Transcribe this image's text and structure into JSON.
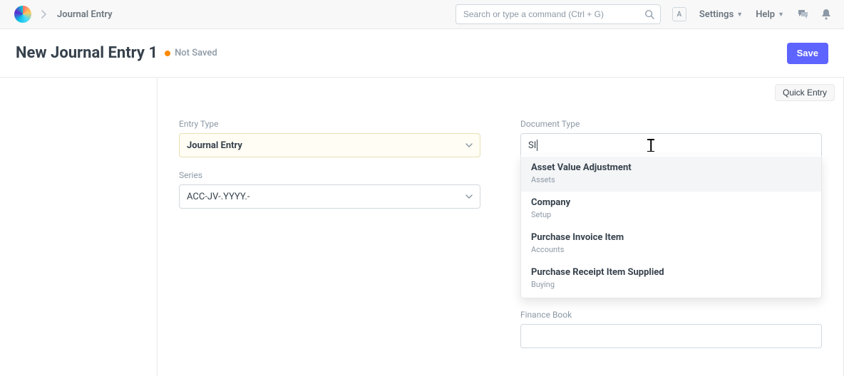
{
  "nav": {
    "breadcrumb": "Journal Entry",
    "search_placeholder": "Search or type a command (Ctrl + G)",
    "avatar_initial": "A",
    "settings_label": "Settings",
    "help_label": "Help"
  },
  "page": {
    "title": "New Journal Entry 1",
    "status_label": "Not Saved",
    "save_label": "Save",
    "quick_entry_label": "Quick Entry"
  },
  "form": {
    "entry_type": {
      "label": "Entry Type",
      "value": "Journal Entry"
    },
    "series": {
      "label": "Series",
      "value": "ACC-JV-.YYYY.-"
    },
    "document_type": {
      "label": "Document Type",
      "value": "SI"
    },
    "finance_book": {
      "label": "Finance Book",
      "value": ""
    },
    "autocomplete": [
      {
        "title": "Asset Value Adjustment",
        "sub": "Assets"
      },
      {
        "title": "Company",
        "sub": "Setup"
      },
      {
        "title": "Purchase Invoice Item",
        "sub": "Accounts"
      },
      {
        "title": "Purchase Receipt Item Supplied",
        "sub": "Buying"
      }
    ]
  }
}
